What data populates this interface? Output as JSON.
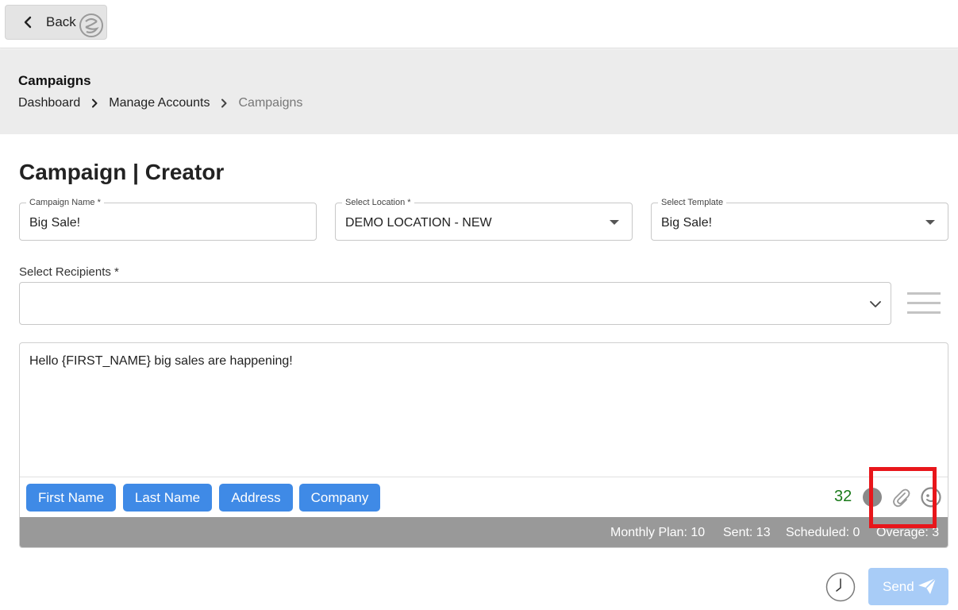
{
  "topbar": {
    "back_label": "Back"
  },
  "header": {
    "title": "Campaigns",
    "breadcrumbs": [
      "Dashboard",
      "Manage Accounts",
      "Campaigns"
    ]
  },
  "page": {
    "title": "Campaign | Creator"
  },
  "form": {
    "campaign_name": {
      "label": "Campaign Name *",
      "value": "Big Sale!"
    },
    "location": {
      "label": "Select Location *",
      "value": "DEMO LOCATION - NEW"
    },
    "template": {
      "label": "Select Template",
      "value": "Big Sale!"
    },
    "recipients": {
      "label": "Select Recipients *",
      "value": ""
    }
  },
  "editor": {
    "message": "Hello {FIRST_NAME} big sales are happening!",
    "tags": [
      "First Name",
      "Last Name",
      "Address",
      "Company"
    ],
    "char_count": "32",
    "icons": [
      "circle-icon",
      "paperclip-icon",
      "emoji-icon"
    ]
  },
  "stats": {
    "monthly_plan": "Monthly Plan: 10",
    "sent": "Sent: 13",
    "scheduled": "Scheduled: 0",
    "overage": "Overage: 3"
  },
  "actions": {
    "send_label": "Send"
  },
  "colors": {
    "accent": "#3f8ae6",
    "send_disabled": "#a8ccf7",
    "highlight": "#e8161b",
    "count_green": "#1a7a1a",
    "stats_bar": "#999999"
  }
}
